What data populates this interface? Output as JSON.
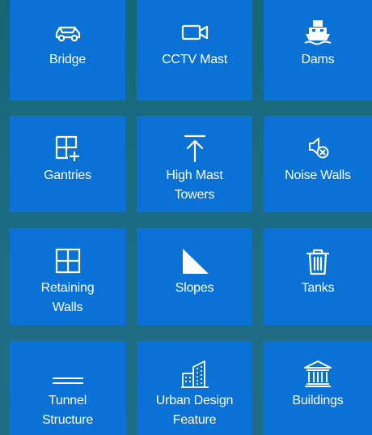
{
  "tiles": [
    {
      "label_lines": [
        "Bridge"
      ],
      "icon": "car-icon"
    },
    {
      "label_lines": [
        "CCTV Mast"
      ],
      "icon": "video-camera-icon"
    },
    {
      "label_lines": [
        "Dams"
      ],
      "icon": "ferry-icon"
    },
    {
      "label_lines": [
        "Gantries"
      ],
      "icon": "grid-add-icon"
    },
    {
      "label_lines": [
        "High Mast",
        "Towers"
      ],
      "icon": "arrow-up-icon"
    },
    {
      "label_lines": [
        "Noise Walls"
      ],
      "icon": "speaker-mute-icon"
    },
    {
      "label_lines": [
        "Retaining",
        "Walls"
      ],
      "icon": "grid-icon"
    },
    {
      "label_lines": [
        "Slopes"
      ],
      "icon": "triangle-slope-icon"
    },
    {
      "label_lines": [
        "Tanks"
      ],
      "icon": "trash-bin-icon"
    },
    {
      "label_lines": [
        "Tunnel",
        "Structure"
      ],
      "icon": "double-line-icon"
    },
    {
      "label_lines": [
        "Urban Design",
        "Feature"
      ],
      "icon": "city-buildings-icon"
    },
    {
      "label_lines": [
        "Buildings"
      ],
      "icon": "classical-building-icon"
    }
  ],
  "colors": {
    "tile": "#0a72d6",
    "background": "#1c6d83",
    "text": "#ffffff"
  }
}
